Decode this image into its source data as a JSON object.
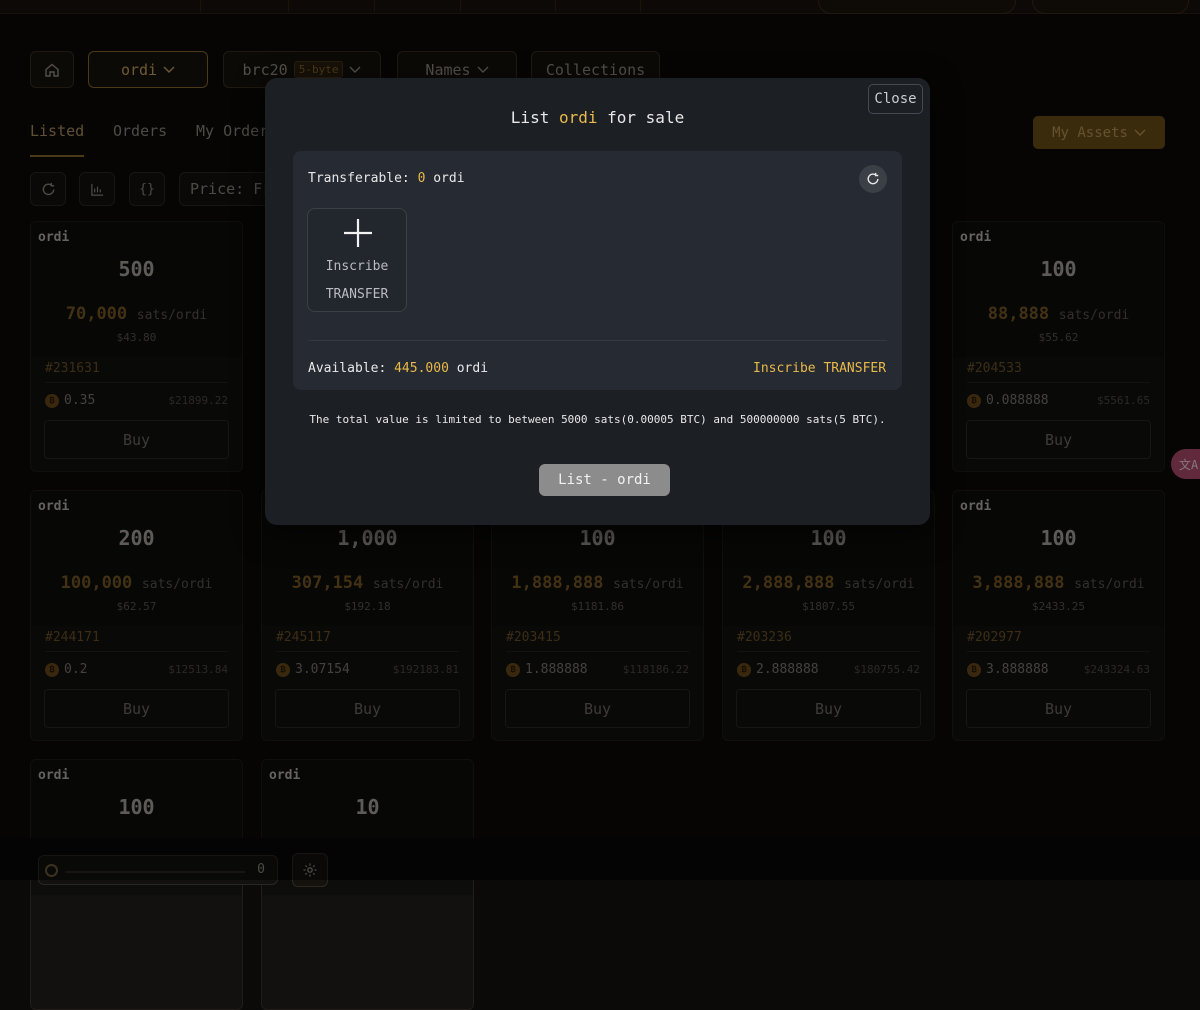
{
  "filters": {
    "ticker_select": "ordi",
    "protocol_select": "brc20",
    "protocol_badge": "5-byte",
    "names_select": "Names",
    "collections": "Collections"
  },
  "tabs": [
    {
      "label": "Listed",
      "active": true
    },
    {
      "label": "Orders",
      "active": false
    },
    {
      "label": "My Order",
      "active": false
    }
  ],
  "my_assets_label": "My Assets",
  "price_filter_label": "Price: Fr",
  "cards": [
    {
      "ticker": "ordi",
      "amount": "500",
      "price": "70,000",
      "unit": "sats/ordi",
      "usd": "$43.80",
      "inscription": "#231631",
      "btc": "0.35",
      "total_usd": "$21899.22",
      "buy": "Buy"
    },
    {
      "ticker": "ordi",
      "amount": "100",
      "price": "88,888",
      "unit": "sats/ordi",
      "usd": "$55.62",
      "inscription": "#204533",
      "btc": "0.088888",
      "total_usd": "$5561.65",
      "buy": "Buy"
    },
    {
      "ticker": "ordi",
      "amount": "200",
      "price": "100,000",
      "unit": "sats/ordi",
      "usd": "$62.57",
      "inscription": "#244171",
      "btc": "0.2",
      "total_usd": "$12513.84",
      "buy": "Buy"
    },
    {
      "ticker": "ordi",
      "amount": "1,000",
      "price": "307,154",
      "unit": "sats/ordi",
      "usd": "$192.18",
      "inscription": "#245117",
      "btc": "3.07154",
      "total_usd": "$192183.81",
      "buy": "Buy"
    },
    {
      "ticker": "ordi",
      "amount": "100",
      "price": "1,888,888",
      "unit": "sats/ordi",
      "usd": "$1181.86",
      "inscription": "#203415",
      "btc": "1.888888",
      "total_usd": "$118186.22",
      "buy": "Buy"
    },
    {
      "ticker": "ordi",
      "amount": "100",
      "price": "2,888,888",
      "unit": "sats/ordi",
      "usd": "$1807.55",
      "inscription": "#203236",
      "btc": "2.888888",
      "total_usd": "$180755.42",
      "buy": "Buy"
    },
    {
      "ticker": "ordi",
      "amount": "100",
      "price": "3,888,888",
      "unit": "sats/ordi",
      "usd": "$2433.25",
      "inscription": "#202977",
      "btc": "3.888888",
      "total_usd": "$243324.63",
      "buy": "Buy"
    },
    {
      "ticker": "ordi",
      "amount": "100"
    },
    {
      "ticker": "ordi",
      "amount": "10"
    }
  ],
  "bottom": {
    "slider_value": "0"
  },
  "translate_glyph": "文A",
  "modal": {
    "close_label": "Close",
    "title_prefix": "List",
    "title_ticker": "ordi",
    "title_suffix": "for sale",
    "transferable_label": "Transferable:",
    "transferable_value": "0",
    "transferable_unit": "ordi",
    "inscribe_line1": "Inscribe",
    "inscribe_line2": "TRANSFER",
    "available_label": "Available:",
    "available_value": "445.000",
    "available_unit": "ordi",
    "inscribe_link": "Inscribe TRANSFER",
    "limit_note": "The total value is limited to between 5000 sats(0.00005 BTC) and 500000000 sats(5 BTC).",
    "list_button": "List - ordi"
  },
  "colors": {
    "accent": "#e9b949",
    "modal_bg": "#1c1f24",
    "inner_bg": "#262a32",
    "list_button_bg": "#8c8c8c"
  },
  "icons": [
    "home-icon",
    "chevron-down-icon",
    "refresh-icon",
    "chart-icon",
    "braces-icon",
    "bitcoin-icon",
    "plus-icon",
    "gear-icon",
    "translate-icon"
  ]
}
